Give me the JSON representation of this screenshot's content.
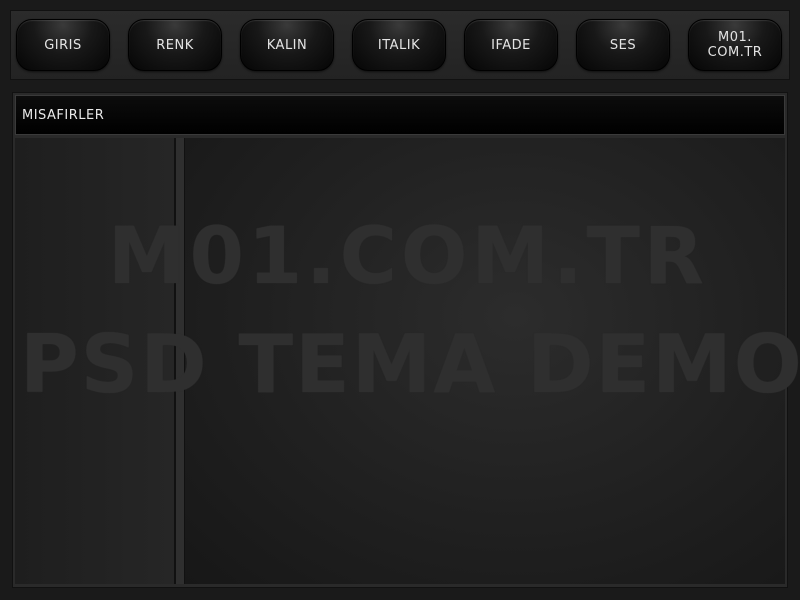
{
  "toolbar": {
    "buttons": [
      {
        "label": "GIRIS"
      },
      {
        "label": "RENK"
      },
      {
        "label": "KALIN"
      },
      {
        "label": "ITALIK"
      },
      {
        "label": "IFADE"
      },
      {
        "label": "SES"
      },
      {
        "label": "M01.\nCOM.TR"
      }
    ]
  },
  "panel": {
    "header": "MISAFIRLER"
  },
  "watermark": {
    "line1": "M01.COM.TR",
    "line2": "PSD TEMA DEMO"
  }
}
